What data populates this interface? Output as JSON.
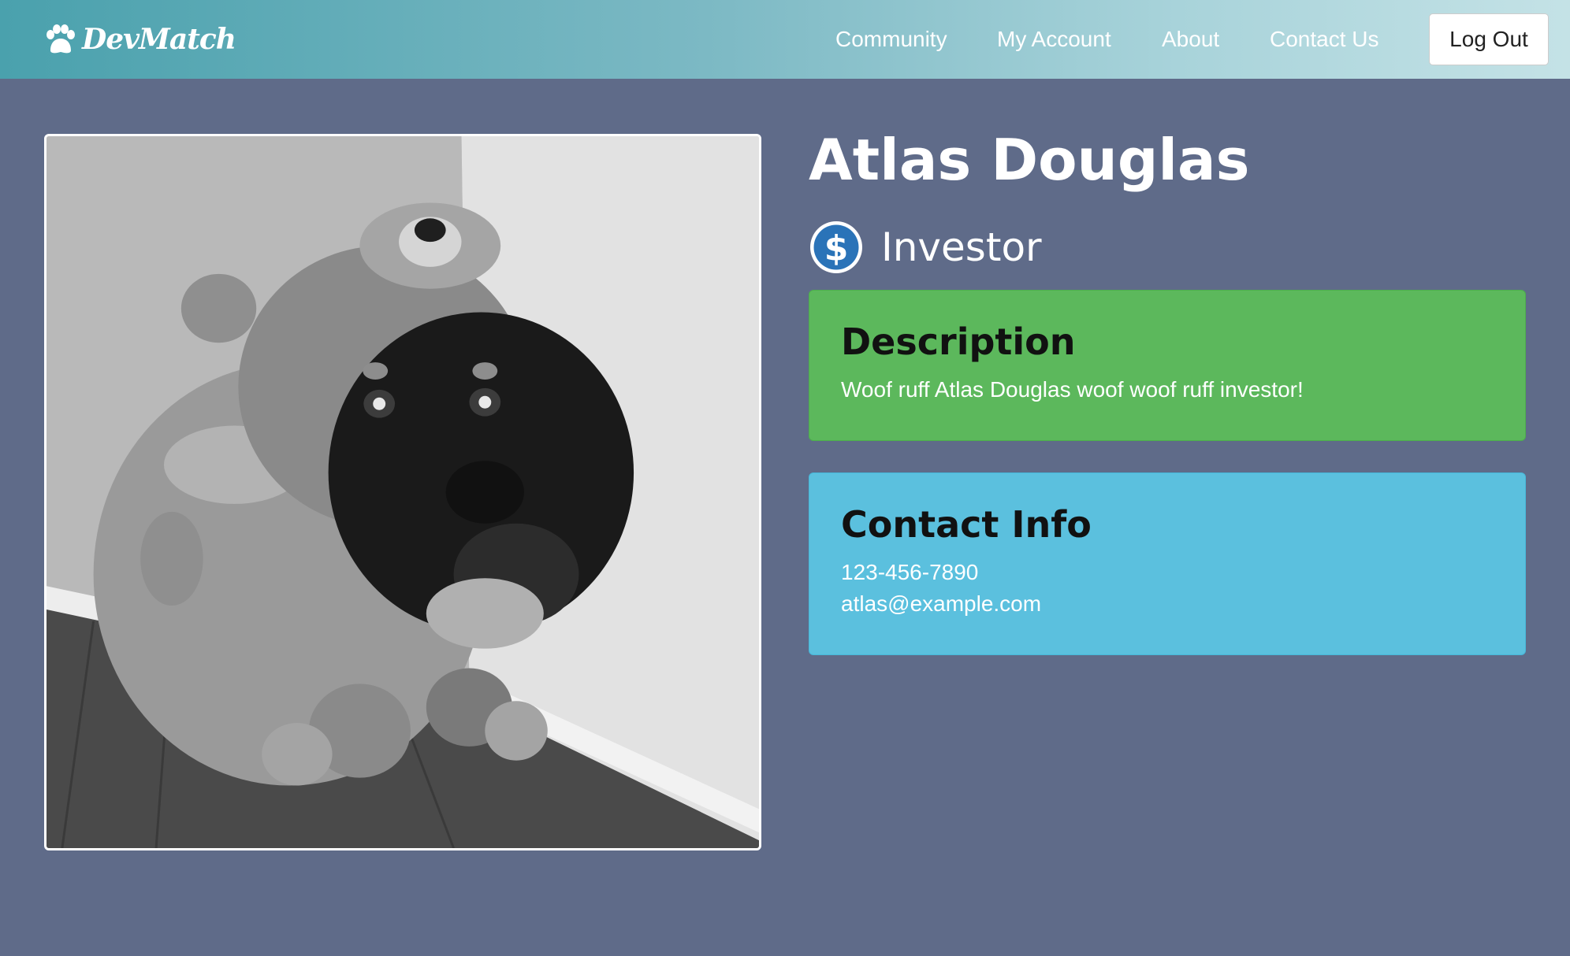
{
  "brand": {
    "name": "DevMatch"
  },
  "nav": {
    "links": [
      "Community",
      "My Account",
      "About",
      "Contact Us"
    ],
    "logout_label": "Log Out"
  },
  "profile": {
    "name": "Atlas Douglas",
    "role": "Investor",
    "role_icon": "dollar-circle-icon",
    "description_title": "Description",
    "description_text": "Woof ruff Atlas Douglas woof woof ruff investor!",
    "contact_title": "Contact Info",
    "phone": "123-456-7890",
    "email": "atlas@example.com"
  },
  "colors": {
    "background": "#5f6b89",
    "navbar_start": "#4aa1ad",
    "navbar_end": "#c4e2e6",
    "description_card": "#5cb85c",
    "contact_card": "#5bc0de",
    "role_icon": "#2a73b8"
  }
}
